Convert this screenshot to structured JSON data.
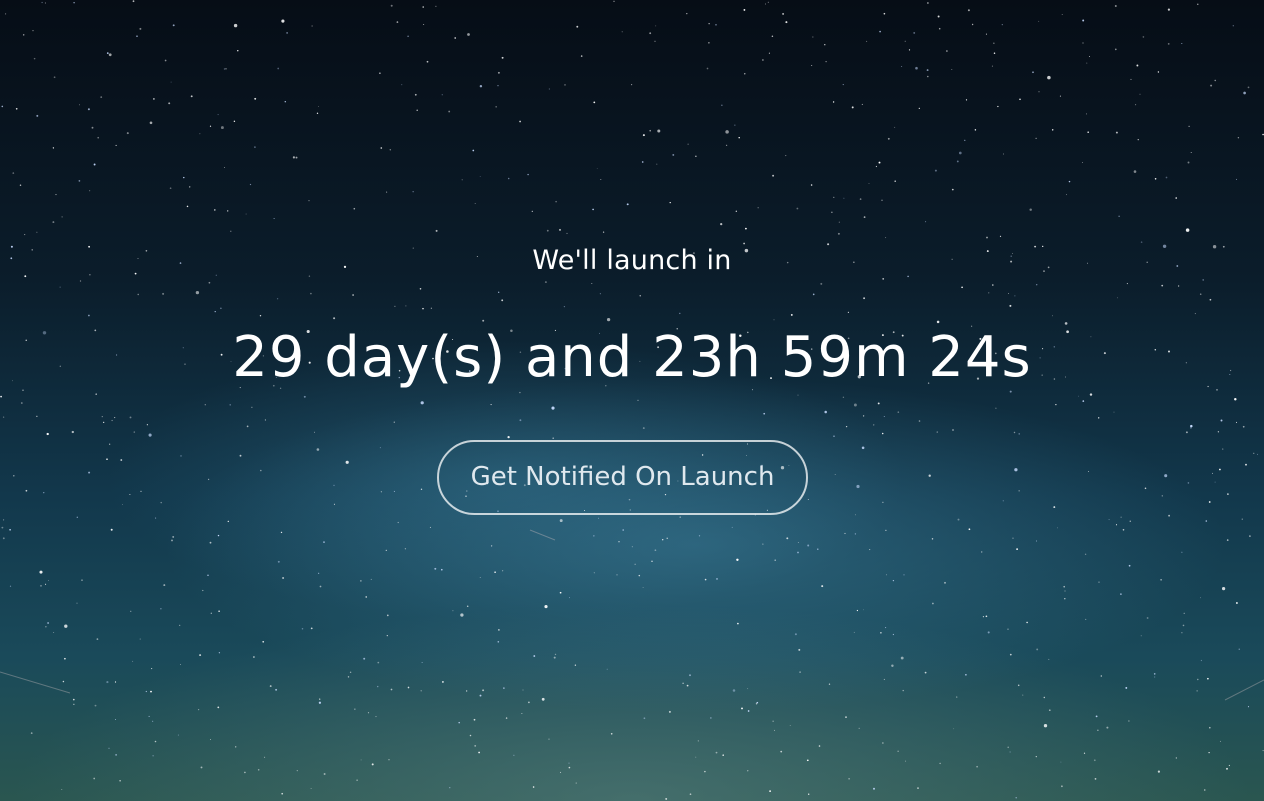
{
  "hero": {
    "subtitle": "We'll launch in",
    "countdown": "29 day(s) and 23h 59m 24s",
    "cta_label": "Get Notified On Launch"
  },
  "colors": {
    "text": "#ffffff",
    "button_border": "#ffffff",
    "sky_top": "#060d16",
    "sky_bottom": "#2a5650"
  }
}
